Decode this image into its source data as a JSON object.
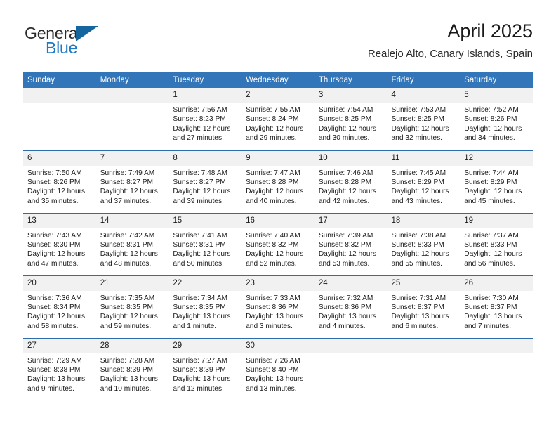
{
  "brand": {
    "name_top": "General",
    "name_bottom": "Blue",
    "logo_icon": "blue-triangle-sail-icon",
    "color_top": "#2b2b2b",
    "color_bottom": "#1f7ac4",
    "triangle_color": "#15659f"
  },
  "header": {
    "title": "April 2025",
    "subtitle": "Realejo Alto, Canary Islands, Spain"
  },
  "theme": {
    "header_blue": "#3275b8",
    "row_rule_blue": "#2e6da9",
    "daynum_band": "#f1f1f1",
    "page_background": "#ffffff"
  },
  "calendar": {
    "weekday_headers": [
      "Sunday",
      "Monday",
      "Tuesday",
      "Wednesday",
      "Thursday",
      "Friday",
      "Saturday"
    ],
    "weeks": [
      [
        {
          "day": "",
          "empty": true
        },
        {
          "day": "",
          "empty": true
        },
        {
          "day": "1",
          "sunrise": "Sunrise: 7:56 AM",
          "sunset": "Sunset: 8:23 PM",
          "daylight": "Daylight: 12 hours and 27 minutes."
        },
        {
          "day": "2",
          "sunrise": "Sunrise: 7:55 AM",
          "sunset": "Sunset: 8:24 PM",
          "daylight": "Daylight: 12 hours and 29 minutes."
        },
        {
          "day": "3",
          "sunrise": "Sunrise: 7:54 AM",
          "sunset": "Sunset: 8:25 PM",
          "daylight": "Daylight: 12 hours and 30 minutes."
        },
        {
          "day": "4",
          "sunrise": "Sunrise: 7:53 AM",
          "sunset": "Sunset: 8:25 PM",
          "daylight": "Daylight: 12 hours and 32 minutes."
        },
        {
          "day": "5",
          "sunrise": "Sunrise: 7:52 AM",
          "sunset": "Sunset: 8:26 PM",
          "daylight": "Daylight: 12 hours and 34 minutes."
        }
      ],
      [
        {
          "day": "6",
          "sunrise": "Sunrise: 7:50 AM",
          "sunset": "Sunset: 8:26 PM",
          "daylight": "Daylight: 12 hours and 35 minutes."
        },
        {
          "day": "7",
          "sunrise": "Sunrise: 7:49 AM",
          "sunset": "Sunset: 8:27 PM",
          "daylight": "Daylight: 12 hours and 37 minutes."
        },
        {
          "day": "8",
          "sunrise": "Sunrise: 7:48 AM",
          "sunset": "Sunset: 8:27 PM",
          "daylight": "Daylight: 12 hours and 39 minutes."
        },
        {
          "day": "9",
          "sunrise": "Sunrise: 7:47 AM",
          "sunset": "Sunset: 8:28 PM",
          "daylight": "Daylight: 12 hours and 40 minutes."
        },
        {
          "day": "10",
          "sunrise": "Sunrise: 7:46 AM",
          "sunset": "Sunset: 8:28 PM",
          "daylight": "Daylight: 12 hours and 42 minutes."
        },
        {
          "day": "11",
          "sunrise": "Sunrise: 7:45 AM",
          "sunset": "Sunset: 8:29 PM",
          "daylight": "Daylight: 12 hours and 43 minutes."
        },
        {
          "day": "12",
          "sunrise": "Sunrise: 7:44 AM",
          "sunset": "Sunset: 8:29 PM",
          "daylight": "Daylight: 12 hours and 45 minutes."
        }
      ],
      [
        {
          "day": "13",
          "sunrise": "Sunrise: 7:43 AM",
          "sunset": "Sunset: 8:30 PM",
          "daylight": "Daylight: 12 hours and 47 minutes."
        },
        {
          "day": "14",
          "sunrise": "Sunrise: 7:42 AM",
          "sunset": "Sunset: 8:31 PM",
          "daylight": "Daylight: 12 hours and 48 minutes."
        },
        {
          "day": "15",
          "sunrise": "Sunrise: 7:41 AM",
          "sunset": "Sunset: 8:31 PM",
          "daylight": "Daylight: 12 hours and 50 minutes."
        },
        {
          "day": "16",
          "sunrise": "Sunrise: 7:40 AM",
          "sunset": "Sunset: 8:32 PM",
          "daylight": "Daylight: 12 hours and 52 minutes."
        },
        {
          "day": "17",
          "sunrise": "Sunrise: 7:39 AM",
          "sunset": "Sunset: 8:32 PM",
          "daylight": "Daylight: 12 hours and 53 minutes."
        },
        {
          "day": "18",
          "sunrise": "Sunrise: 7:38 AM",
          "sunset": "Sunset: 8:33 PM",
          "daylight": "Daylight: 12 hours and 55 minutes."
        },
        {
          "day": "19",
          "sunrise": "Sunrise: 7:37 AM",
          "sunset": "Sunset: 8:33 PM",
          "daylight": "Daylight: 12 hours and 56 minutes."
        }
      ],
      [
        {
          "day": "20",
          "sunrise": "Sunrise: 7:36 AM",
          "sunset": "Sunset: 8:34 PM",
          "daylight": "Daylight: 12 hours and 58 minutes."
        },
        {
          "day": "21",
          "sunrise": "Sunrise: 7:35 AM",
          "sunset": "Sunset: 8:35 PM",
          "daylight": "Daylight: 12 hours and 59 minutes."
        },
        {
          "day": "22",
          "sunrise": "Sunrise: 7:34 AM",
          "sunset": "Sunset: 8:35 PM",
          "daylight": "Daylight: 13 hours and 1 minute."
        },
        {
          "day": "23",
          "sunrise": "Sunrise: 7:33 AM",
          "sunset": "Sunset: 8:36 PM",
          "daylight": "Daylight: 13 hours and 3 minutes."
        },
        {
          "day": "24",
          "sunrise": "Sunrise: 7:32 AM",
          "sunset": "Sunset: 8:36 PM",
          "daylight": "Daylight: 13 hours and 4 minutes."
        },
        {
          "day": "25",
          "sunrise": "Sunrise: 7:31 AM",
          "sunset": "Sunset: 8:37 PM",
          "daylight": "Daylight: 13 hours and 6 minutes."
        },
        {
          "day": "26",
          "sunrise": "Sunrise: 7:30 AM",
          "sunset": "Sunset: 8:37 PM",
          "daylight": "Daylight: 13 hours and 7 minutes."
        }
      ],
      [
        {
          "day": "27",
          "sunrise": "Sunrise: 7:29 AM",
          "sunset": "Sunset: 8:38 PM",
          "daylight": "Daylight: 13 hours and 9 minutes."
        },
        {
          "day": "28",
          "sunrise": "Sunrise: 7:28 AM",
          "sunset": "Sunset: 8:39 PM",
          "daylight": "Daylight: 13 hours and 10 minutes."
        },
        {
          "day": "29",
          "sunrise": "Sunrise: 7:27 AM",
          "sunset": "Sunset: 8:39 PM",
          "daylight": "Daylight: 13 hours and 12 minutes."
        },
        {
          "day": "30",
          "sunrise": "Sunrise: 7:26 AM",
          "sunset": "Sunset: 8:40 PM",
          "daylight": "Daylight: 13 hours and 13 minutes."
        },
        {
          "day": "",
          "empty": true
        },
        {
          "day": "",
          "empty": true
        },
        {
          "day": "",
          "empty": true
        }
      ]
    ]
  }
}
